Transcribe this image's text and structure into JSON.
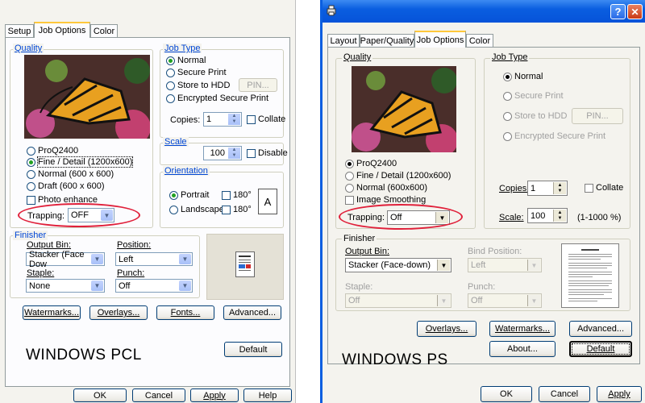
{
  "pcl": {
    "tabs": [
      "Setup",
      "Job Options",
      "Color"
    ],
    "quality": {
      "label": "Quality",
      "options": [
        "ProQ2400",
        "Fine / Detail (1200x600)",
        "Normal (600 x 600)",
        "Draft (600 x 600)"
      ],
      "selected": "Fine / Detail (1200x600)",
      "photo_enhance": "Photo enhance",
      "trapping_label": "Trapping:",
      "trapping_value": "OFF"
    },
    "job_type": {
      "label": "Job Type",
      "options": [
        "Normal",
        "Secure Print",
        "Store to HDD",
        "Encrypted Secure Print"
      ],
      "selected": "Normal",
      "pin_label": "PIN...",
      "copies_label": "Copies:",
      "copies_value": "1",
      "collate": "Collate"
    },
    "scale": {
      "label": "Scale",
      "value": "100",
      "disable": "Disable"
    },
    "orientation": {
      "label": "Orientation",
      "portrait": "Portrait",
      "landscape": "Landscape",
      "r180a": "180°",
      "r180b": "180°",
      "preview_letter": "A"
    },
    "finisher": {
      "label": "Finisher",
      "output_bin_label": "Output Bin:",
      "output_bin_value": "Stacker (Face Dow",
      "position_label": "Position:",
      "position_value": "Left",
      "staple_label": "Staple:",
      "staple_value": "None",
      "punch_label": "Punch:",
      "punch_value": "Off"
    },
    "buttons": {
      "watermarks": "Watermarks...",
      "overlays": "Overlays...",
      "fonts": "Fonts...",
      "advanced": "Advanced...",
      "default": "Default",
      "ok": "OK",
      "cancel": "Cancel",
      "apply": "Apply",
      "help": "Help"
    },
    "caption": "WINDOWS PCL"
  },
  "ps": {
    "title_buttons": {
      "help": "?",
      "close": "✕"
    },
    "tabs": [
      "Layout",
      "Paper/Quality",
      "Job Options",
      "Color"
    ],
    "quality": {
      "label": "Quality",
      "options": [
        "ProQ2400",
        "Fine / Detail (1200x600)",
        "Normal (600x600)"
      ],
      "selected": "ProQ2400",
      "image_smoothing": "Image Smoothing",
      "trapping_label": "Trapping:",
      "trapping_value": "Off"
    },
    "job_type": {
      "label": "Job Type",
      "options": [
        "Normal",
        "Secure Print",
        "Store to HDD",
        "Encrypted Secure Print"
      ],
      "selected": "Normal",
      "pin_label": "PIN..."
    },
    "copies_label": "Copies:",
    "copies_value": "1",
    "collate": "Collate",
    "scale_label": "Scale:",
    "scale_value": "100",
    "scale_range": "(1-1000 %)",
    "finisher": {
      "label": "Finisher",
      "output_bin_label": "Output Bin:",
      "output_bin_value": "Stacker (Face-down)",
      "bind_position_label": "Bind Position:",
      "bind_position_value": "Left",
      "staple_label": "Staple:",
      "staple_value": "Off",
      "punch_label": "Punch:",
      "punch_value": "Off"
    },
    "buttons": {
      "overlays": "Overlays...",
      "watermarks": "Watermarks...",
      "advanced": "Advanced...",
      "about": "About...",
      "default": "Default",
      "ok": "OK",
      "cancel": "Cancel",
      "apply": "Apply"
    },
    "caption": "WINDOWS PS"
  },
  "colors": {
    "highlight_oval": "#e0203a",
    "xp_title_blue": "#0a5ee0",
    "dialog_bg": "#f4f3ee"
  }
}
